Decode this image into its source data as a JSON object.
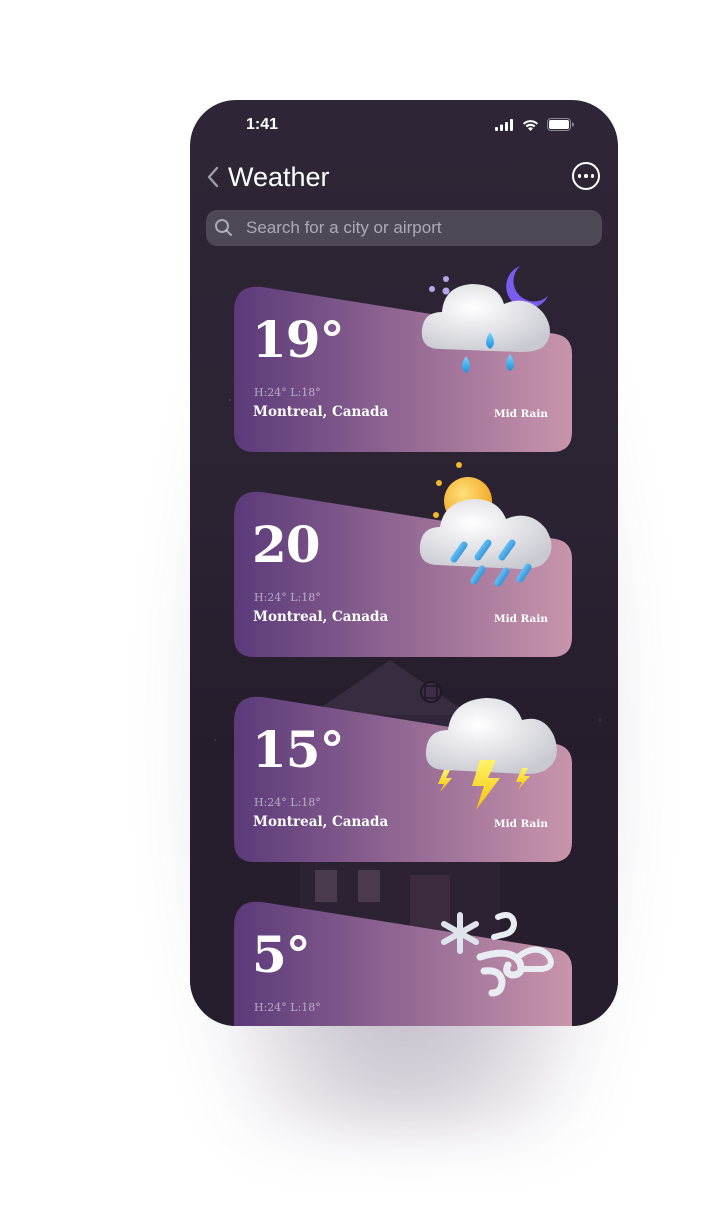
{
  "status_bar": {
    "time": "1:41"
  },
  "nav": {
    "title": "Weather"
  },
  "search": {
    "placeholder": "Search for a city or airport"
  },
  "cards": [
    {
      "temp": "19°",
      "hl": "H:24° L:18°",
      "city": "Montreal, Canada",
      "condition": "Mid Rain",
      "icon": "moon-cloud-rain-icon"
    },
    {
      "temp": "20",
      "hl": "H:24° L:18°",
      "city": "Montreal, Canada",
      "condition": "Mid Rain",
      "icon": "sun-cloud-rain-icon"
    },
    {
      "temp": "15°",
      "hl": "H:24° L:18°",
      "city": "Montreal, Canada",
      "condition": "Mid Rain",
      "icon": "cloud-lightning-icon"
    },
    {
      "temp": "5°",
      "hl": "H:24° L:18°",
      "city": "",
      "condition": "",
      "icon": "snow-wind-icon"
    }
  ],
  "colors": {
    "card_left": "#5b3a7a",
    "card_right": "#c48ea9",
    "background": "#2b2332"
  }
}
